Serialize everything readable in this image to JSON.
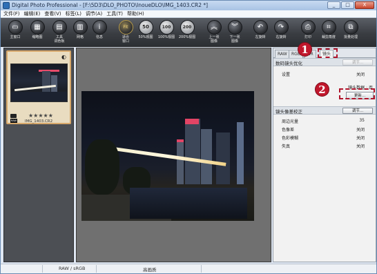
{
  "window": {
    "title": "Digital Photo Professional - [F:\\5D3\\DLO_PHOTO\\InoueDLO\\IMG_1403.CR2 *]",
    "controls": [
      "_",
      "□",
      "X"
    ]
  },
  "menu": [
    "文件(F)",
    "编辑(E)",
    "查看(V)",
    "标签(L)",
    "调节(A)",
    "工具(T)",
    "帮助(H)"
  ],
  "toolbar": [
    {
      "label": "主窗口",
      "icon": "main-window-icon"
    },
    {
      "label": "缩略图",
      "icon": "thumbnail-icon"
    },
    {
      "label": "工具\n调色板",
      "icon": "tool-palette-icon"
    },
    {
      "label": "网格",
      "icon": "grid-icon"
    },
    {
      "label": "信息",
      "icon": "info-icon",
      "glyph": "i"
    },
    {
      "label": "适合\n窗口",
      "icon": "fit-window-icon",
      "glyph": "Fit"
    },
    {
      "label": "50%视图",
      "icon": "zoom-50-icon",
      "glyph": "50"
    },
    {
      "label": "100%视图",
      "icon": "zoom-100-icon",
      "glyph": "100"
    },
    {
      "label": "200%视图",
      "icon": "zoom-200-icon",
      "glyph": "200"
    },
    {
      "label": "上一张\n图像",
      "icon": "previous-image-icon",
      "glyph": "︽"
    },
    {
      "label": "下一张\n图像",
      "icon": "next-image-icon",
      "glyph": "︾"
    },
    {
      "label": "左旋转",
      "icon": "rotate-left-icon",
      "glyph": "↶"
    },
    {
      "label": "右旋转",
      "icon": "rotate-right-icon",
      "glyph": "↷"
    },
    {
      "label": "打印",
      "icon": "print-icon"
    },
    {
      "label": "裁剪角度",
      "icon": "crop-angle-icon"
    },
    {
      "label": "批量处理",
      "icon": "batch-process-icon"
    }
  ],
  "thumbnail": {
    "filename": "IMG_1403.CR2",
    "stars": "★★★★★"
  },
  "palette": {
    "tabs": [
      "RAW",
      "RGB",
      "NR",
      "镜头"
    ],
    "active_tab": "镜头",
    "lens_opt": {
      "title": "数码镜头优化",
      "button": "调节...",
      "setting_label": "设置",
      "setting_value": "关闭",
      "lens_data_label": "镜头数据 : 否",
      "update_button": "更新..."
    },
    "aberration": {
      "title": "镜头像差校正",
      "button": "调节...",
      "rows": [
        {
          "label": "周边光量",
          "value": "35"
        },
        {
          "label": "色像差",
          "value": "关闭"
        },
        {
          "label": "色彩模糊",
          "value": "关闭"
        },
        {
          "label": "失真",
          "value": "关闭"
        }
      ]
    }
  },
  "callouts": [
    "1",
    "2"
  ],
  "status": {
    "colorspace": "RAW / sRGB",
    "quality": "高画质"
  }
}
